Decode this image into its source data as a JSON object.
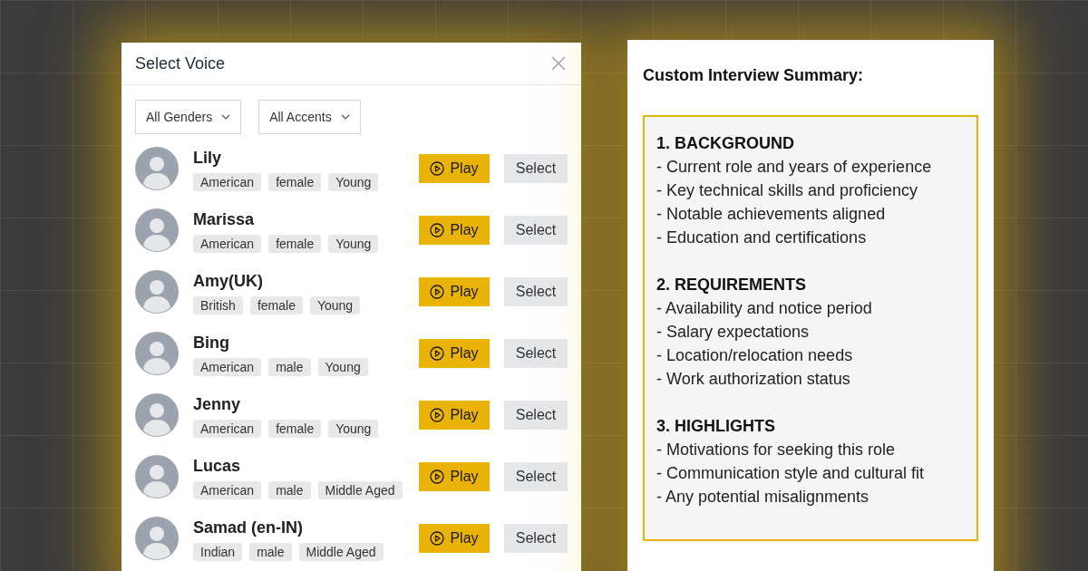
{
  "voice_dialog": {
    "title": "Select Voice",
    "filters": [
      {
        "label": "All Genders"
      },
      {
        "label": "All Accents"
      }
    ],
    "voices": [
      {
        "name": "Lily",
        "tags": [
          "American",
          "female",
          "Young"
        ],
        "play_label": "Play",
        "select_label": "Select"
      },
      {
        "name": "Marissa",
        "tags": [
          "American",
          "female",
          "Young"
        ],
        "play_label": "Play",
        "select_label": "Select"
      },
      {
        "name": "Amy(UK)",
        "tags": [
          "British",
          "female",
          "Young"
        ],
        "play_label": "Play",
        "select_label": "Select"
      },
      {
        "name": "Bing",
        "tags": [
          "American",
          "male",
          "Young"
        ],
        "play_label": "Play",
        "select_label": "Select"
      },
      {
        "name": "Jenny",
        "tags": [
          "American",
          "female",
          "Young"
        ],
        "play_label": "Play",
        "select_label": "Select"
      },
      {
        "name": "Lucas",
        "tags": [
          "American",
          "male",
          "Middle Aged"
        ],
        "play_label": "Play",
        "select_label": "Select"
      },
      {
        "name": "Samad (en-IN)",
        "tags": [
          "Indian",
          "male",
          "Middle Aged"
        ],
        "play_label": "Play",
        "select_label": "Select"
      }
    ]
  },
  "summary": {
    "title": "Custom Interview Summary:",
    "sections": [
      {
        "heading": "1. BACKGROUND",
        "items": [
          "- Current role and years of experience",
          "- Key technical skills and proficiency",
          "- Notable achievements aligned",
          "- Education and certifications"
        ]
      },
      {
        "heading": "2. REQUIREMENTS",
        "items": [
          "- Availability and notice period",
          "- Salary expectations",
          "- Location/relocation needs",
          "- Work authorization status"
        ]
      },
      {
        "heading": "3. HIGHLIGHTS",
        "items": [
          "- Motivations for seeking this role",
          "- Communication style and cultural fit",
          "- Any potential misalignments"
        ]
      }
    ]
  }
}
